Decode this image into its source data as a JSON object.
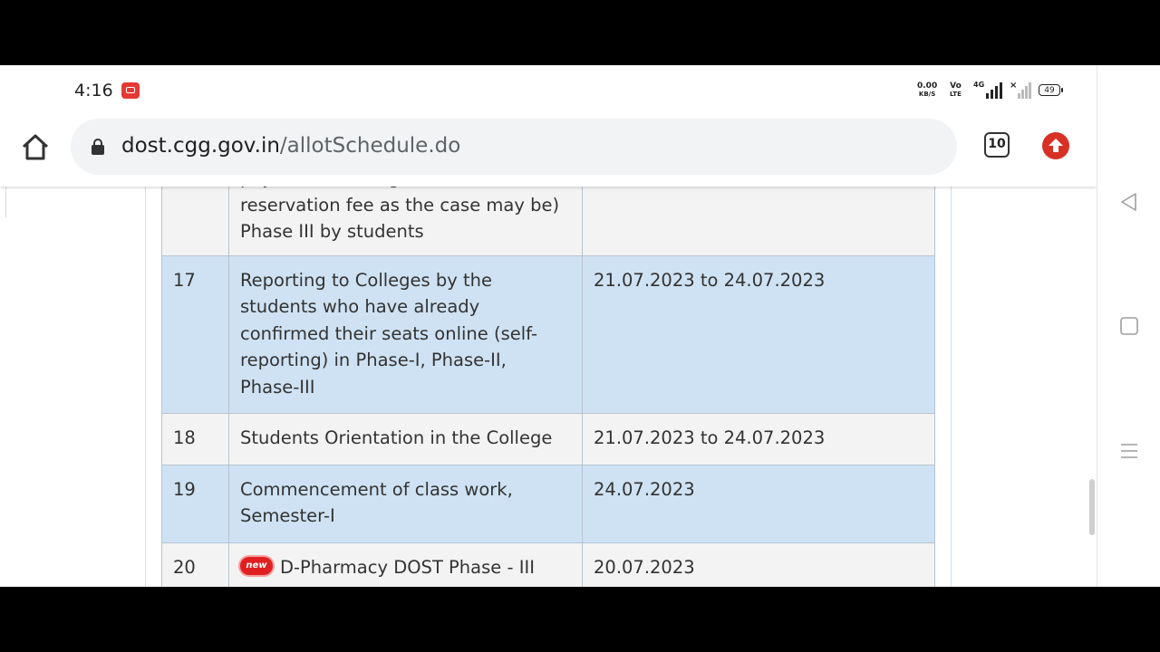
{
  "status_bar": {
    "time": "4:16",
    "net_speed_value": "0.00",
    "net_speed_unit": "KB/S",
    "volte_top": "Vo",
    "volte_bottom": "LTE",
    "network_type": "4G",
    "battery": "49"
  },
  "browser": {
    "url_domain": "dost.cgg.gov.in",
    "url_path": "/allotSchedule.do",
    "tab_count": "10"
  },
  "schedule": {
    "rows": [
      {
        "sno": "",
        "desc": "payment of college fee/ seat reservation fee as the case may be) Phase III by students",
        "date": ""
      },
      {
        "sno": "17",
        "desc": "Reporting to Colleges by the students who have already confirmed their seats online (self-reporting) in Phase-I, Phase-II, Phase-III",
        "date": "21.07.2023 to 24.07.2023"
      },
      {
        "sno": "18",
        "desc": "Students Orientation in the College",
        "date": "21.07.2023 to 24.07.2023"
      },
      {
        "sno": "19",
        "desc": "Commencement of class work, Semester-I",
        "date": "24.07.2023"
      },
      {
        "sno": "20",
        "badge": "new",
        "desc": "D-Pharmacy DOST Phase - III",
        "date": "20.07.2023"
      }
    ]
  },
  "colors": {
    "row_odd": "#f3f3f3",
    "row_even": "#cfe2f3",
    "update_badge": "#d93025",
    "record_indicator": "#e53935"
  }
}
